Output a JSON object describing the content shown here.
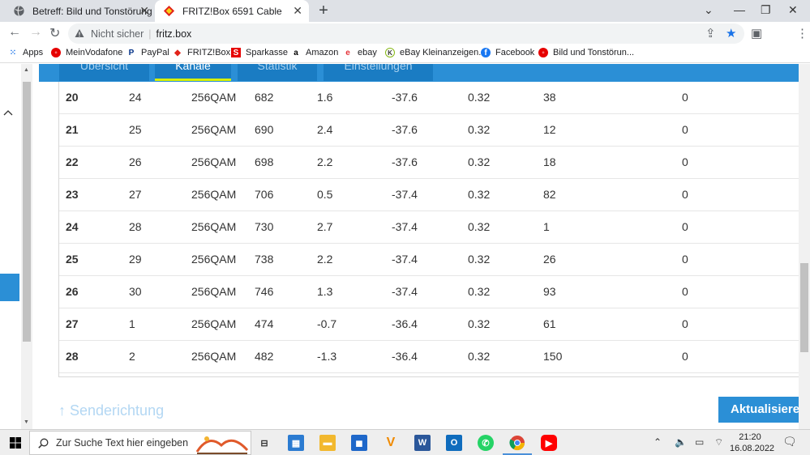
{
  "browser": {
    "tabs": [
      {
        "title": "Betreff: Bild und Tonstörung im T",
        "active": false
      },
      {
        "title": "FRITZ!Box 6591 Cable",
        "active": true
      }
    ],
    "address": {
      "security_label": "Nicht sicher",
      "url": "fritz.box"
    },
    "bookmarks": [
      {
        "label": "Apps",
        "icon": "apps-grid-icon"
      },
      {
        "label": "MeinVodafone",
        "icon": "vodafone-icon"
      },
      {
        "label": "PayPal",
        "icon": "paypal-icon"
      },
      {
        "label": "FRITZ!Box",
        "icon": "fritzbox-icon"
      },
      {
        "label": "Sparkasse",
        "icon": "sparkasse-icon"
      },
      {
        "label": "Amazon",
        "icon": "amazon-icon"
      },
      {
        "label": "ebay",
        "icon": "ebay-icon"
      },
      {
        "label": "eBay Kleinanzeigen...",
        "icon": "kleinanzeigen-icon"
      },
      {
        "label": "Facebook",
        "icon": "facebook-icon"
      },
      {
        "label": "Bild und Tonstörun...",
        "icon": "vodafone-icon"
      }
    ]
  },
  "page": {
    "tabs": [
      {
        "label": "Übersicht",
        "active": false
      },
      {
        "label": "Kanäle",
        "active": true
      },
      {
        "label": "Statistik",
        "active": false
      },
      {
        "label": "Einstellungen",
        "active": false
      }
    ],
    "rows": [
      [
        "20",
        "24",
        "256QAM",
        "682",
        "1.6",
        "-37.6",
        "0.32",
        "38",
        "0"
      ],
      [
        "21",
        "25",
        "256QAM",
        "690",
        "2.4",
        "-37.6",
        "0.32",
        "12",
        "0"
      ],
      [
        "22",
        "26",
        "256QAM",
        "698",
        "2.2",
        "-37.6",
        "0.32",
        "18",
        "0"
      ],
      [
        "23",
        "27",
        "256QAM",
        "706",
        "0.5",
        "-37.4",
        "0.32",
        "82",
        "0"
      ],
      [
        "24",
        "28",
        "256QAM",
        "730",
        "2.7",
        "-37.4",
        "0.32",
        "1",
        "0"
      ],
      [
        "25",
        "29",
        "256QAM",
        "738",
        "2.2",
        "-37.4",
        "0.32",
        "26",
        "0"
      ],
      [
        "26",
        "30",
        "256QAM",
        "746",
        "1.3",
        "-37.4",
        "0.32",
        "93",
        "0"
      ],
      [
        "27",
        "1",
        "256QAM",
        "474",
        "-0.7",
        "-36.4",
        "0.32",
        "61",
        "0"
      ],
      [
        "28",
        "2",
        "256QAM",
        "482",
        "-1.3",
        "-36.4",
        "0.32",
        "150",
        "0"
      ]
    ],
    "section_heading": "↑ Senderichtung",
    "refresh_button": "Aktualisieren"
  },
  "taskbar": {
    "search_placeholder": "Zur Suche Text hier eingeben",
    "time": "21:20",
    "date": "16.08.2022"
  },
  "colors": {
    "fritz_blue": "#2b8fd6",
    "active_underline": "#d8f000"
  }
}
